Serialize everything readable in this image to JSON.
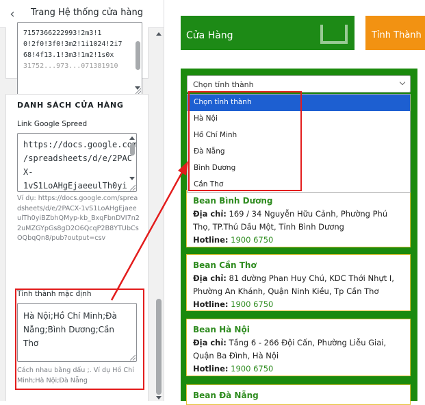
{
  "panel": {
    "title": "Trang Hệ thống cửa hàng",
    "top_textarea_lines": [
      "7157366222993!2m3!1",
      "0!2f0!3f0!3m2!1i1024!2i7",
      "68!4f13.1!3m3!1m2!1s0x",
      "31752...973...071381910"
    ],
    "section_title": "DANH SÁCH CỬA HÀNG",
    "link_label": "Link Google Spreed",
    "link_lines": [
      "https://docs.google.com",
      "/spreadsheets/d/e/2PAC",
      "X-",
      "1vS1LoAHgEjaeeulTh0yi"
    ],
    "example_text": "Ví dụ: https://docs.google.com/spreadsheets/d/e/2PACX-1vS1LoAHgEjaeeulTh0yiBZbhQMyp-kb_BxqFbnDVI7n22uMZGYpGs8gD2O6QcqP2B8YTUbCsOQbqQn8/pub?output=csv",
    "province_label": "Tỉnh thành mặc định",
    "province_value": "Hà Nội;Hồ Chí Minh;Đà Nẵng;Bình Dương;Cần Thơ",
    "province_hint": "Cách nhau bằng dấu ;. Ví dụ Hồ Chí Minh;Hà Nội;Đà Nẵng"
  },
  "preview": {
    "store_button": "Cửa Hàng",
    "province_button": "Tỉnh Thành",
    "select_value": "Chọn tỉnh thành",
    "options": [
      "Chọn tỉnh thành",
      "Hà Nội",
      "Hồ Chí Minh",
      "Đà Nẵng",
      "Bình Dương",
      "Cần Thơ"
    ],
    "address_label": "Địa chỉ:",
    "hotline_label": "Hotline:",
    "stores": [
      {
        "name": "Bean Bình Dương",
        "address": "169 / 34 Nguyễn Hữu Cảnh, Phường Phú Thọ, TP.Thủ Dầu Một, Tỉnh Bình Dương",
        "hotline": "1900 6750"
      },
      {
        "name": "Bean Cần Thơ",
        "address": "81 đường Phan Huy Chú, KDC Thới Nhựt I, Phường An Khánh, Quận Ninh Kiều, Tp Cần Thơ",
        "hotline": "1900 6750"
      },
      {
        "name": "Bean Hà Nội",
        "address": "Tầng 6 - 266 Đội Cấn, Phường Liễu Giai, Quận Ba Đình, Hà Nội",
        "hotline": "1900 6750"
      },
      {
        "name": "Bean Đà Nẵng"
      }
    ]
  },
  "colors": {
    "green": "#1b8a0d",
    "orange": "#f29212",
    "highlight_blue": "#1d5fd1",
    "annotation_red": "#e31c1c"
  }
}
